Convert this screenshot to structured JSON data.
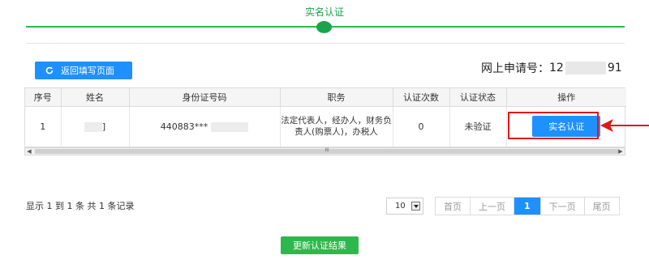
{
  "step": {
    "title": "实名认证"
  },
  "toolbar": {
    "back_label": "返回填写页面"
  },
  "application": {
    "label": "网上申请号：",
    "number_prefix": "12",
    "number_suffix": "91"
  },
  "table": {
    "headers": [
      "序号",
      "姓名",
      "身份证号码",
      "职务",
      "认证次数",
      "认证状态",
      "操作"
    ],
    "rows": [
      {
        "index": "1",
        "name_suffix": "]",
        "id_prefix": "440883***",
        "duty": "法定代表人，经办人，财务负责人(购票人)，办税人",
        "auth_count": "0",
        "status": "未验证",
        "action": "实名认证"
      }
    ]
  },
  "scrollbar": {
    "grip": "III"
  },
  "pagination": {
    "summary": "显示 1 到 1 条 共 1 条记录",
    "page_size": "10",
    "first": "首页",
    "prev": "上一页",
    "current": "1",
    "next": "下一页",
    "last": "尾页"
  },
  "actions": {
    "refresh_label": "更新认证结果"
  },
  "colors": {
    "accent_green": "#1aa34a",
    "button_blue": "#1e90ff",
    "highlight_red": "#e01818"
  }
}
